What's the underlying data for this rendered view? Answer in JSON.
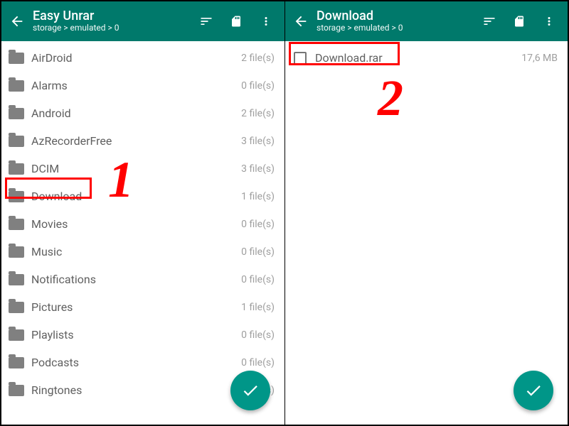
{
  "colors": {
    "primary": "#00796b",
    "accent": "#009688",
    "annotation": "#ff0000"
  },
  "panes": [
    {
      "title": "Easy Unrar",
      "breadcrumb": "storage > emulated > 0",
      "annotation_number": "1",
      "items": [
        {
          "name": "AirDroid",
          "meta": "2 file(s)",
          "type": "folder",
          "highlighted": false
        },
        {
          "name": "Alarms",
          "meta": "0 file(s)",
          "type": "folder",
          "highlighted": false
        },
        {
          "name": "Android",
          "meta": "2 file(s)",
          "type": "folder",
          "highlighted": false
        },
        {
          "name": "AzRecorderFree",
          "meta": "3 file(s)",
          "type": "folder",
          "highlighted": false
        },
        {
          "name": "DCIM",
          "meta": "3 file(s)",
          "type": "folder",
          "highlighted": false
        },
        {
          "name": "Download",
          "meta": "1 file(s)",
          "type": "folder",
          "highlighted": true
        },
        {
          "name": "Movies",
          "meta": "0 file(s)",
          "type": "folder",
          "highlighted": false
        },
        {
          "name": "Music",
          "meta": "0 file(s)",
          "type": "folder",
          "highlighted": false
        },
        {
          "name": "Notifications",
          "meta": "0 file(s)",
          "type": "folder",
          "highlighted": false
        },
        {
          "name": "Pictures",
          "meta": "1 file(s)",
          "type": "folder",
          "highlighted": false
        },
        {
          "name": "Playlists",
          "meta": "0 file(s)",
          "type": "folder",
          "highlighted": false
        },
        {
          "name": "Podcasts",
          "meta": "0 file(s)",
          "type": "folder",
          "highlighted": false
        },
        {
          "name": "Ringtones",
          "meta": "0 file(s)",
          "type": "folder",
          "highlighted": false
        }
      ]
    },
    {
      "title": "Download",
      "breadcrumb": "storage > emulated > 0",
      "annotation_number": "2",
      "items": [
        {
          "name": "Download.rar",
          "meta": "17,6 MB",
          "type": "file",
          "highlighted": true
        }
      ]
    }
  ]
}
